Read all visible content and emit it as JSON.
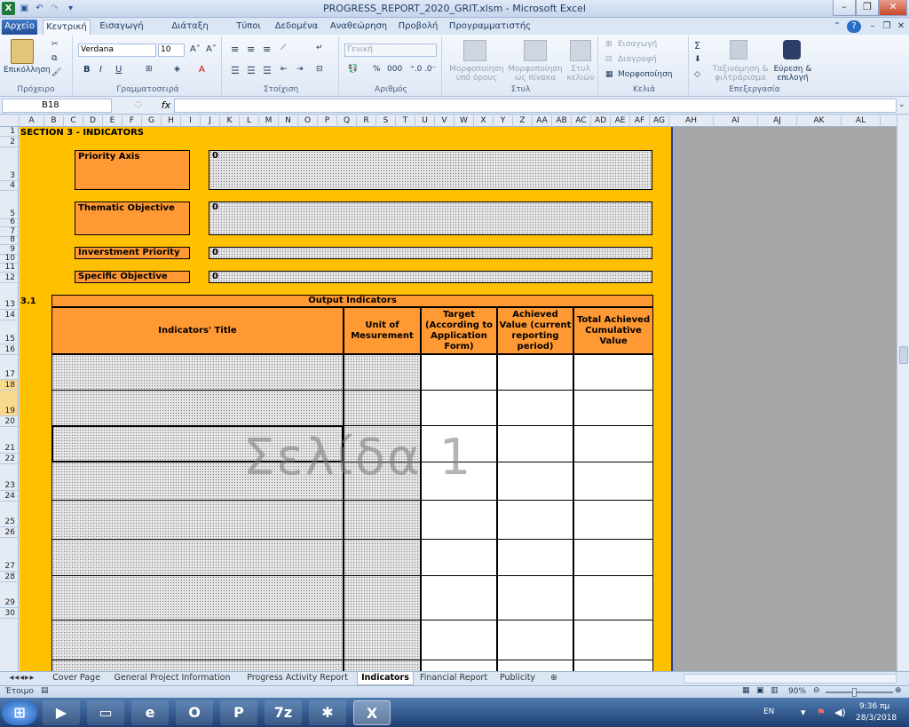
{
  "window": {
    "title": "PROGRESS_REPORT_2020_GRIT.xlsm - Microsoft Excel",
    "minimize": "–",
    "restore": "❐",
    "close": "✕"
  },
  "tabs": {
    "file": "Αρχείο",
    "home": "Κεντρική",
    "insert": "Εισαγωγή",
    "page_layout": "Διάταξη σελίδας",
    "formulas": "Τύποι",
    "data": "Δεδομένα",
    "review": "Αναθεώρηση",
    "view": "Προβολή",
    "developer": "Προγραμματιστής"
  },
  "ribbon": {
    "paste": "Επικόλληση",
    "clipboard": "Πρόχειρο",
    "font_name": "Verdana",
    "font_size": "10",
    "font_group": "Γραμματοσειρά",
    "bold": "B",
    "italic": "I",
    "underline": "U",
    "alignment_group": "Στοίχιση",
    "number_format": "Γενική",
    "number_group": "Αριθμός",
    "cond_format": "Μορφοποίηση υπό όρους",
    "format_table": "Μορφοποίηση ως πίνακα",
    "cell_styles": "Στυλ κελιών",
    "styles_group": "Στυλ",
    "insert_cells": "Εισαγωγή",
    "delete_cells": "Διαγραφή",
    "format_cells": "Μορφοποίηση",
    "cells_group": "Κελιά",
    "sort_filter": "Ταξινόμηση & φιλτράρισμα",
    "find_select": "Εύρεση & επιλογή",
    "editing_group": "Επεξεργασία"
  },
  "formula_bar": {
    "name_box": "B18",
    "fx": "fx",
    "value": ""
  },
  "columns": [
    "A",
    "B",
    "C",
    "D",
    "E",
    "F",
    "G",
    "H",
    "I",
    "J",
    "K",
    "L",
    "M",
    "N",
    "O",
    "P",
    "Q",
    "R",
    "S",
    "T",
    "U",
    "V",
    "W",
    "X",
    "Y",
    "Z",
    "AA",
    "AB",
    "AC",
    "AD",
    "AE",
    "AF",
    "AG",
    "AH",
    "AI",
    "AJ",
    "AK",
    "AL"
  ],
  "rows": [
    "1",
    "2",
    "3",
    "4",
    "5",
    "6",
    "7",
    "8",
    "9",
    "10",
    "11",
    "12",
    "13",
    "14",
    "15",
    "16",
    "17",
    "18",
    "19",
    "20",
    "21",
    "22",
    "23",
    "24",
    "25",
    "26",
    "27",
    "28",
    "29",
    "30"
  ],
  "sheet": {
    "section_title": "SECTION 3 - INDICATORS",
    "fields": [
      {
        "label": "Priority Axis",
        "value": "0"
      },
      {
        "label": "Thematic Objective",
        "value": "0"
      },
      {
        "label": "Inverstment Priority",
        "value": "0"
      },
      {
        "label": "Specific Objective",
        "value": "0"
      }
    ],
    "subsection": "3.1",
    "table_title": "Output Indicators",
    "headers": [
      "Indicators' Title",
      "Unit of Mesurement",
      "Target (According to Application Form)",
      "Achieved Value (current reporting period)",
      "Total Achieved Cumulative Value"
    ],
    "watermark": "Σελίδα 1"
  },
  "sheet_tabs": [
    "Cover Page",
    "General Project Information",
    "Progress Activity Report",
    "Indicators",
    "Financial Report",
    "Publicity"
  ],
  "active_sheet": "Indicators",
  "status": {
    "ready": "Έτοιμο",
    "zoom": "90%"
  },
  "taskbar": {
    "language": "EN",
    "time": "9:36 πμ",
    "date": "28/3/2018"
  },
  "colors": {
    "orange_bg": "#ffc000",
    "label_orange": "#ff9933",
    "file_tab": "#2b579a"
  }
}
